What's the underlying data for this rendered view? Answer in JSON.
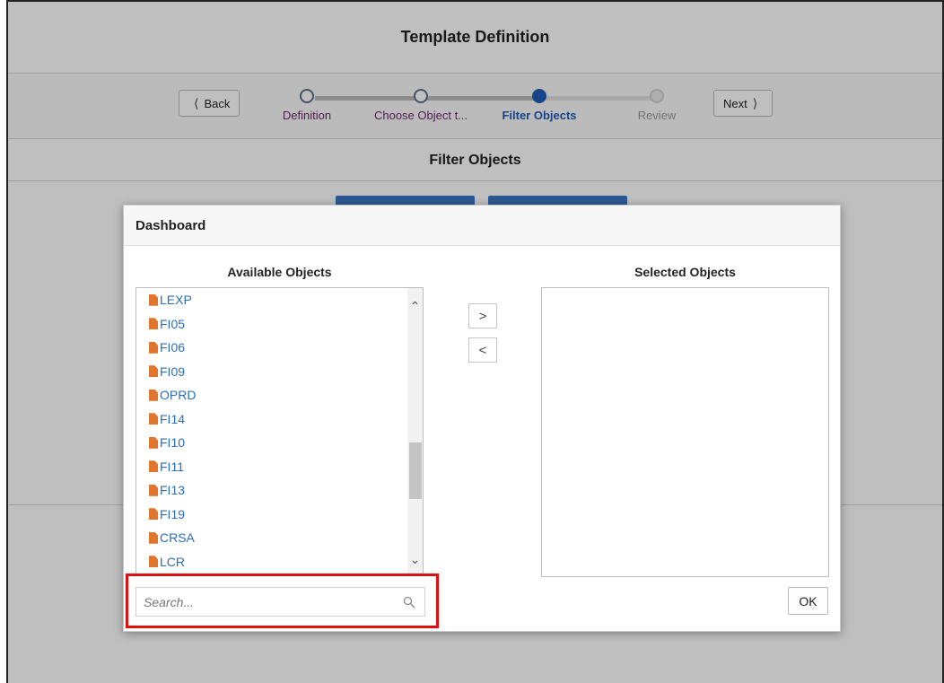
{
  "page": {
    "title": "Template Definition",
    "section_title": "Filter Objects"
  },
  "train": {
    "back_label": "Back",
    "next_label": "Next",
    "steps": [
      {
        "label": "Definition",
        "state": "visited"
      },
      {
        "label": "Choose Object t...",
        "state": "visited"
      },
      {
        "label": "Filter Objects",
        "state": "active"
      },
      {
        "label": "Review",
        "state": "future"
      }
    ]
  },
  "dialog": {
    "title": "Dashboard",
    "available_title": "Available Objects",
    "selected_title": "Selected Objects",
    "available_items": [
      "LEXP",
      "FI05",
      "FI06",
      "FI09",
      "OPRD",
      "FI14",
      "FI10",
      "FI11",
      "FI13",
      "FI19",
      "CRSA",
      "LCR"
    ],
    "selected_items": [],
    "move_right_symbol": ">",
    "move_left_symbol": "<",
    "search": {
      "placeholder": "Search...",
      "value": ""
    },
    "ok_label": "OK"
  },
  "colors": {
    "accent": "#1f5cb5",
    "link": "#2a6ebb",
    "doc_icon": "#e0752e",
    "highlight": "#e01010"
  }
}
